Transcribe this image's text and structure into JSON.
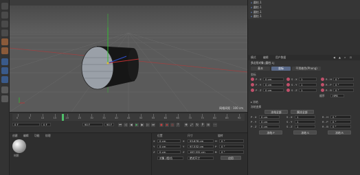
{
  "objects": [
    {
      "name": "圆柱.1"
    },
    {
      "name": "圆柱.1"
    },
    {
      "name": "圆柱.1"
    },
    {
      "name": "圆柱.1"
    }
  ],
  "viewport": {
    "grid_spacing": "网格间距 : 100 cm"
  },
  "attributes": {
    "menu": [
      "模式",
      "编辑",
      "用户数据"
    ],
    "object_title": "多边形对象 [圆柱.1]",
    "tabs": [
      "基本",
      "坐标",
      "平滑着色(Phong)"
    ],
    "section_coords": "坐标",
    "pos": {
      "x": "0 cm",
      "y": "0 cm",
      "z": "0 cm"
    },
    "scale": {
      "x": "1",
      "y": "1",
      "z": "1"
    },
    "rot": {
      "h": "0 °",
      "p": "0 °",
      "b": "0 °"
    },
    "order_label": "顺序",
    "order_value": "HPB",
    "freeze_section": "▸ 冻结",
    "freeze_sub": "冻结变换",
    "freeze_all": "冻结全部",
    "freeze_btn": "解冻全部",
    "fpos": {
      "x": "0 cm",
      "y": "0 cm",
      "z": "0 cm"
    },
    "fscale": {
      "x": "1",
      "y": "1",
      "z": "1"
    },
    "frot": {
      "h": "0 °",
      "p": "0 °",
      "b": "0 °"
    },
    "freeze_pos": "冻结 P",
    "freeze_scale": "冻结 S",
    "freeze_rot": "冻结 R"
  },
  "timeline": {
    "ticks": [
      "0",
      "5",
      "10",
      "15",
      "20",
      "25",
      "30",
      "35",
      "40",
      "45",
      "50",
      "55",
      "60",
      "65",
      "70",
      "75",
      "80",
      "85",
      "90"
    ],
    "current": "0 F",
    "start": "0 F",
    "end": "90 F",
    "end2": "90 F"
  },
  "materials": {
    "menu": [
      "创建",
      "编辑",
      "功能",
      "纹理"
    ],
    "mat_name": "材质"
  },
  "coords": {
    "headers": [
      "位置",
      "尺寸",
      "旋转"
    ],
    "pos": {
      "x": "0 cm",
      "y": "0 cm",
      "z": "0 cm"
    },
    "size": {
      "x": "93.878 cm",
      "y": "97.532 cm",
      "z": "187.532 cm"
    },
    "rot": {
      "h": "0 °",
      "p": "0 °",
      "b": "0 °"
    },
    "mode1": "对象 (相对)",
    "mode2": "绝对尺寸",
    "apply": "应用"
  },
  "colors": {
    "accent": "#5a6a8a",
    "obj": "#151515",
    "cap": "#9aa0a8"
  }
}
